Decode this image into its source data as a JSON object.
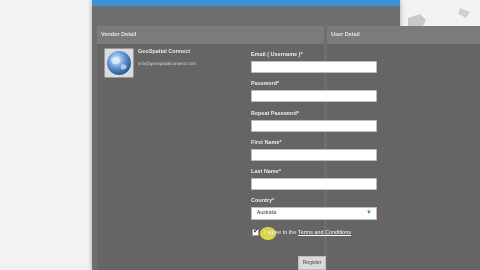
{
  "left_panel": {
    "header": "Vendor Detail",
    "org_name": "GeoSpatial Connect",
    "org_email": "info@geospatialconnect.com"
  },
  "right_panel": {
    "header": "User Detail",
    "fields": [
      {
        "label": "Email ( Username )*",
        "value": ""
      },
      {
        "label": "Password*",
        "value": ""
      },
      {
        "label": "Repeat Password*",
        "value": ""
      },
      {
        "label": "First Name*",
        "value": ""
      },
      {
        "label": "Last Name*",
        "value": ""
      }
    ],
    "country": {
      "label": "Country*",
      "selected": "Australia"
    },
    "agree": {
      "prefix": "I agree to the",
      "link": "Terms and Conditions",
      "checked": true
    },
    "register_label": "Register"
  },
  "colors": {
    "accent": "#3e93d6",
    "panel": "#656565",
    "highlight": "#e6e24a"
  }
}
